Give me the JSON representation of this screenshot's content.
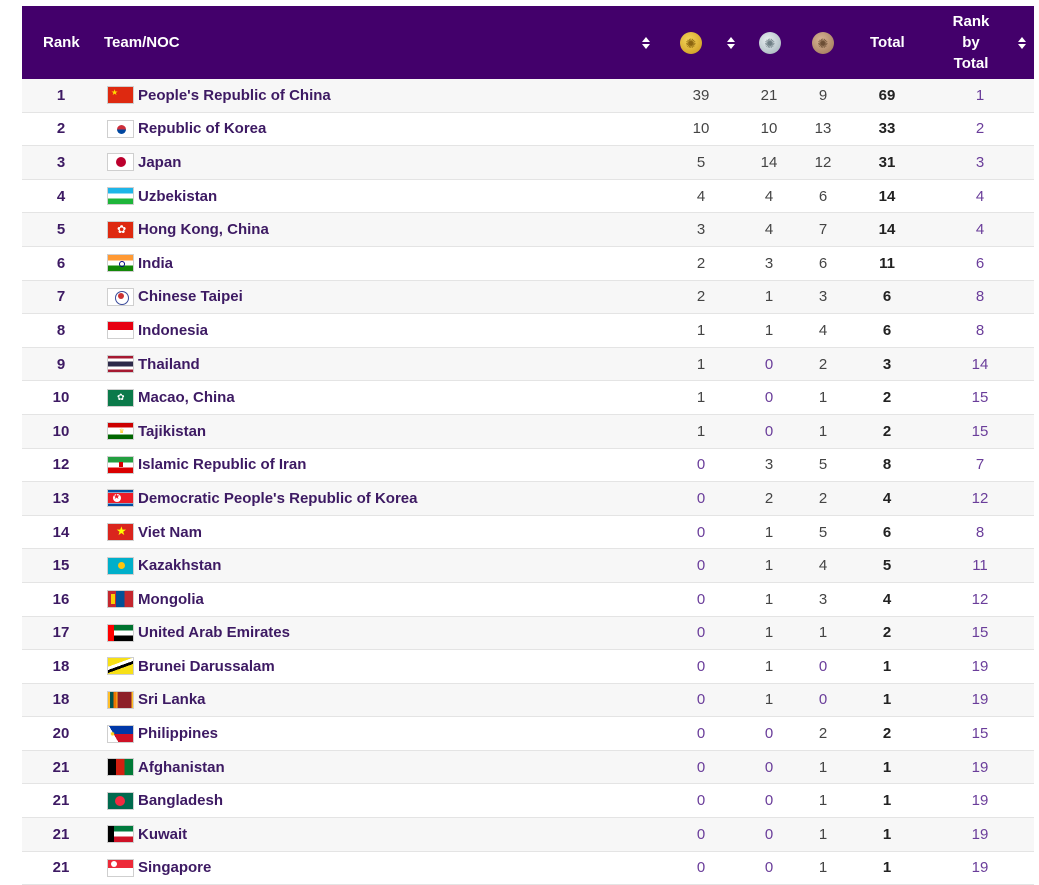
{
  "header": {
    "rank": "Rank",
    "team": "Team/NOC",
    "total": "Total",
    "rank_by_total_l1": "Rank",
    "rank_by_total_l2": "by",
    "rank_by_total_l3": "Total",
    "gold_icon": "gold-medal-icon",
    "silver_icon": "silver-medal-icon",
    "bronze_icon": "bronze-medal-icon"
  },
  "colors": {
    "header_bg": "#43006b",
    "gold": "#d9a820",
    "silver": "#a9b6bd",
    "bronze": "#b08a6a",
    "link": "#3d1a63"
  },
  "rows": [
    {
      "rank": "1",
      "name": "People's Republic of China",
      "gold": "39",
      "silver": "21",
      "bronze": "9",
      "total": "69",
      "rbt": "1",
      "flag": "china-flag"
    },
    {
      "rank": "2",
      "name": "Republic of Korea",
      "gold": "10",
      "silver": "10",
      "bronze": "13",
      "total": "33",
      "rbt": "2",
      "flag": "korea-flag"
    },
    {
      "rank": "3",
      "name": "Japan",
      "gold": "5",
      "silver": "14",
      "bronze": "12",
      "total": "31",
      "rbt": "3",
      "flag": "japan-flag"
    },
    {
      "rank": "4",
      "name": "Uzbekistan",
      "gold": "4",
      "silver": "4",
      "bronze": "6",
      "total": "14",
      "rbt": "4",
      "flag": "uzbekistan-flag"
    },
    {
      "rank": "5",
      "name": "Hong Kong, China",
      "gold": "3",
      "silver": "4",
      "bronze": "7",
      "total": "14",
      "rbt": "4",
      "flag": "hong-kong-flag"
    },
    {
      "rank": "6",
      "name": "India",
      "gold": "2",
      "silver": "3",
      "bronze": "6",
      "total": "11",
      "rbt": "6",
      "flag": "india-flag"
    },
    {
      "rank": "7",
      "name": "Chinese Taipei",
      "gold": "2",
      "silver": "1",
      "bronze": "3",
      "total": "6",
      "rbt": "8",
      "flag": "chinese-taipei-flag"
    },
    {
      "rank": "8",
      "name": "Indonesia",
      "gold": "1",
      "silver": "1",
      "bronze": "4",
      "total": "6",
      "rbt": "8",
      "flag": "indonesia-flag"
    },
    {
      "rank": "9",
      "name": "Thailand",
      "gold": "1",
      "silver": "0",
      "bronze": "2",
      "total": "3",
      "rbt": "14",
      "flag": "thailand-flag"
    },
    {
      "rank": "10",
      "name": "Macao, China",
      "gold": "1",
      "silver": "0",
      "bronze": "1",
      "total": "2",
      "rbt": "15",
      "flag": "macao-flag"
    },
    {
      "rank": "10",
      "name": "Tajikistan",
      "gold": "1",
      "silver": "0",
      "bronze": "1",
      "total": "2",
      "rbt": "15",
      "flag": "tajikistan-flag"
    },
    {
      "rank": "12",
      "name": "Islamic Republic of Iran",
      "gold": "0",
      "silver": "3",
      "bronze": "5",
      "total": "8",
      "rbt": "7",
      "flag": "iran-flag"
    },
    {
      "rank": "13",
      "name": "Democratic People's Republic of Korea",
      "gold": "0",
      "silver": "2",
      "bronze": "2",
      "total": "4",
      "rbt": "12",
      "flag": "dprk-flag"
    },
    {
      "rank": "14",
      "name": "Viet Nam",
      "gold": "0",
      "silver": "1",
      "bronze": "5",
      "total": "6",
      "rbt": "8",
      "flag": "vietnam-flag"
    },
    {
      "rank": "15",
      "name": "Kazakhstan",
      "gold": "0",
      "silver": "1",
      "bronze": "4",
      "total": "5",
      "rbt": "11",
      "flag": "kazakhstan-flag"
    },
    {
      "rank": "16",
      "name": "Mongolia",
      "gold": "0",
      "silver": "1",
      "bronze": "3",
      "total": "4",
      "rbt": "12",
      "flag": "mongolia-flag"
    },
    {
      "rank": "17",
      "name": "United Arab Emirates",
      "gold": "0",
      "silver": "1",
      "bronze": "1",
      "total": "2",
      "rbt": "15",
      "flag": "uae-flag"
    },
    {
      "rank": "18",
      "name": "Brunei Darussalam",
      "gold": "0",
      "silver": "1",
      "bronze": "0",
      "total": "1",
      "rbt": "19",
      "flag": "brunei-flag"
    },
    {
      "rank": "18",
      "name": "Sri Lanka",
      "gold": "0",
      "silver": "1",
      "bronze": "0",
      "total": "1",
      "rbt": "19",
      "flag": "sri-lanka-flag"
    },
    {
      "rank": "20",
      "name": "Philippines",
      "gold": "0",
      "silver": "0",
      "bronze": "2",
      "total": "2",
      "rbt": "15",
      "flag": "philippines-flag"
    },
    {
      "rank": "21",
      "name": "Afghanistan",
      "gold": "0",
      "silver": "0",
      "bronze": "1",
      "total": "1",
      "rbt": "19",
      "flag": "afghanistan-flag"
    },
    {
      "rank": "21",
      "name": "Bangladesh",
      "gold": "0",
      "silver": "0",
      "bronze": "1",
      "total": "1",
      "rbt": "19",
      "flag": "bangladesh-flag"
    },
    {
      "rank": "21",
      "name": "Kuwait",
      "gold": "0",
      "silver": "0",
      "bronze": "1",
      "total": "1",
      "rbt": "19",
      "flag": "kuwait-flag"
    },
    {
      "rank": "21",
      "name": "Singapore",
      "gold": "0",
      "silver": "0",
      "bronze": "1",
      "total": "1",
      "rbt": "19",
      "flag": "singapore-flag"
    }
  ]
}
